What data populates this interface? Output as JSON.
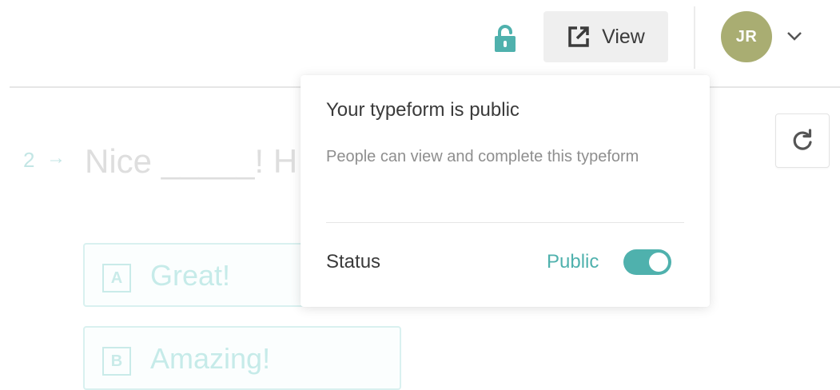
{
  "header": {
    "view_label": "View",
    "avatar_initials": "JR",
    "lock_icon": "unlocked-padlock-icon",
    "view_icon": "external-link-icon"
  },
  "refresh": {
    "icon": "refresh-icon"
  },
  "form_preview": {
    "question_number": "2",
    "question_arrow": "→",
    "question_text": "Nice _____! H",
    "choices": [
      {
        "key": "A",
        "label": "Great!"
      },
      {
        "key": "B",
        "label": "Amazing!"
      }
    ]
  },
  "popover": {
    "title": "Your typeform is public",
    "description": "People can view and complete this typeform",
    "status_label": "Status",
    "status_value": "Public",
    "toggle_on": true
  },
  "colors": {
    "accent": "#4fb1ad",
    "avatar": "#a9ad72",
    "view_button_bg": "#efefef"
  }
}
